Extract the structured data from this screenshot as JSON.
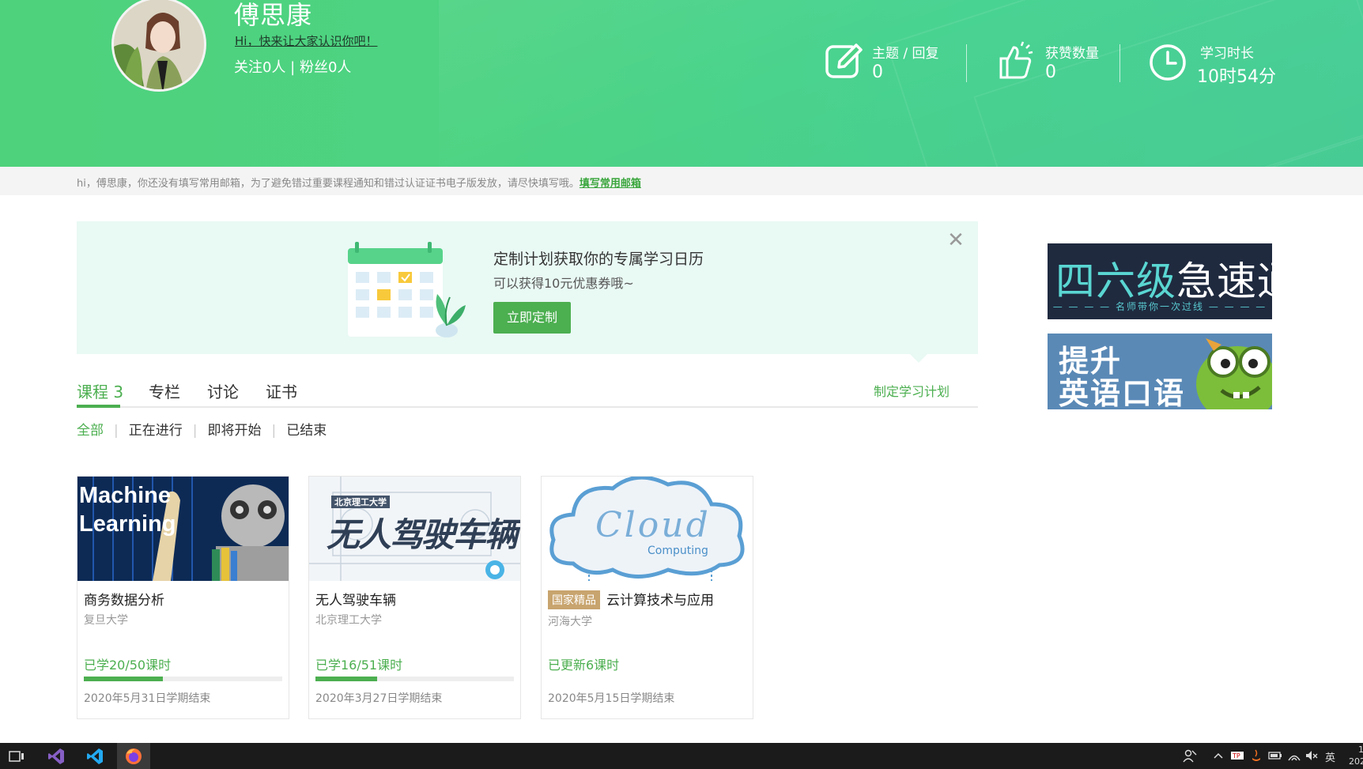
{
  "profile": {
    "username": "傅思康",
    "intro_link": "Hi，快来让大家认识你吧！",
    "follow_text": "关注0人 | 粉丝0人"
  },
  "stats": [
    {
      "label": "主题 / 回复",
      "value": "0",
      "icon": "edit-icon"
    },
    {
      "label": "获赞数量",
      "value": "0",
      "icon": "thumbs-up-icon"
    },
    {
      "label": "学习时长",
      "value": "10时54分",
      "icon": "clock-icon"
    }
  ],
  "notice": {
    "text": "hi，傅思康，你还没有填写常用邮箱，为了避免错过重要课程通知和错过认证证书电子版发放，请尽快填写哦。",
    "link": "填写常用邮箱"
  },
  "promo": {
    "title": "定制计划获取你的专属学习日历",
    "subtitle": "可以获得10元优惠券哦~",
    "button": "立即定制",
    "close": "✕"
  },
  "tabs": [
    {
      "label": "课程 3",
      "active": true
    },
    {
      "label": "专栏",
      "active": false
    },
    {
      "label": "讨论",
      "active": false
    },
    {
      "label": "证书",
      "active": false
    }
  ],
  "plan_link": "制定学习计划",
  "filters": [
    {
      "label": "全部",
      "active": true
    },
    {
      "label": "正在进行",
      "active": false
    },
    {
      "label": "即将开始",
      "active": false
    },
    {
      "label": "已结束",
      "active": false
    }
  ],
  "courses": [
    {
      "name": "商务数据分析",
      "school": "复旦大学",
      "progress_text": "已学20/50课时",
      "progress": 0.4,
      "end": "2020年5月31日学期结束",
      "thumb_text": [
        "Machine",
        "Learning"
      ]
    },
    {
      "name": "无人驾驶车辆",
      "school": "北京理工大学",
      "progress_text": "已学16/51课时",
      "progress": 0.31,
      "end": "2020年3月27日学期结束",
      "thumb_text": [
        "北京理工大学",
        "无人驾驶车辆"
      ]
    },
    {
      "badge": "国家精品",
      "name": "云计算技术与应用",
      "school": "河海大学",
      "progress_text": "已更新6课时",
      "end": "2020年5月15日学期结束",
      "thumb_text": [
        "Cloud",
        "Computing"
      ]
    }
  ],
  "ads": {
    "ad1": {
      "title_a": "四六级",
      "title_b": "急速通关",
      "tagline": "名师带你一次过线"
    },
    "ad2": {
      "line1": "提升",
      "line2": "英语口语"
    }
  },
  "taskbar": {
    "apps": [
      "task-view-icon",
      "visual-studio-icon",
      "vscode-icon",
      "firefox-icon"
    ],
    "lang": "英",
    "clock": "1",
    "year": "202"
  },
  "colors": {
    "brand_green": "#4caf50",
    "header_green": "#4dd386",
    "badge_gold": "#c8a46e"
  }
}
